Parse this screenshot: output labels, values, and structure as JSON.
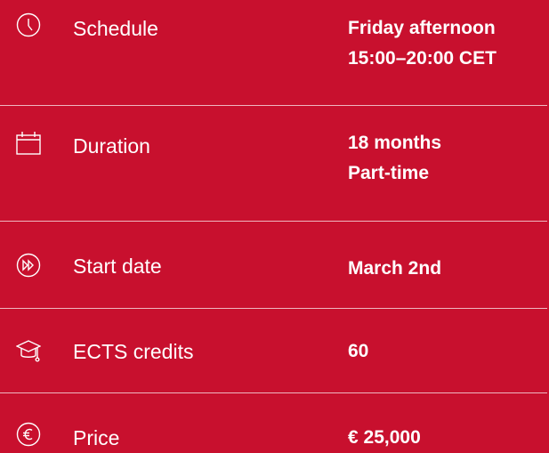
{
  "details": [
    {
      "icon": "clock-icon",
      "label": "Schedule",
      "value_lines": [
        "Friday afternoon",
        "15:00–20:00 CET"
      ]
    },
    {
      "icon": "calendar-icon",
      "label": "Duration",
      "value_lines": [
        "18 months",
        "Part-time"
      ]
    },
    {
      "icon": "fast-forward-icon",
      "label": "Start date",
      "value_lines": [
        "March 2nd"
      ]
    },
    {
      "icon": "graduation-cap-icon",
      "label": "ECTS credits",
      "value_lines": [
        "60"
      ]
    },
    {
      "icon": "euro-icon",
      "label": "Price",
      "value_lines": [
        "€ 25,000"
      ]
    }
  ],
  "colors": {
    "background": "#c8102e",
    "text": "#ffffff"
  }
}
